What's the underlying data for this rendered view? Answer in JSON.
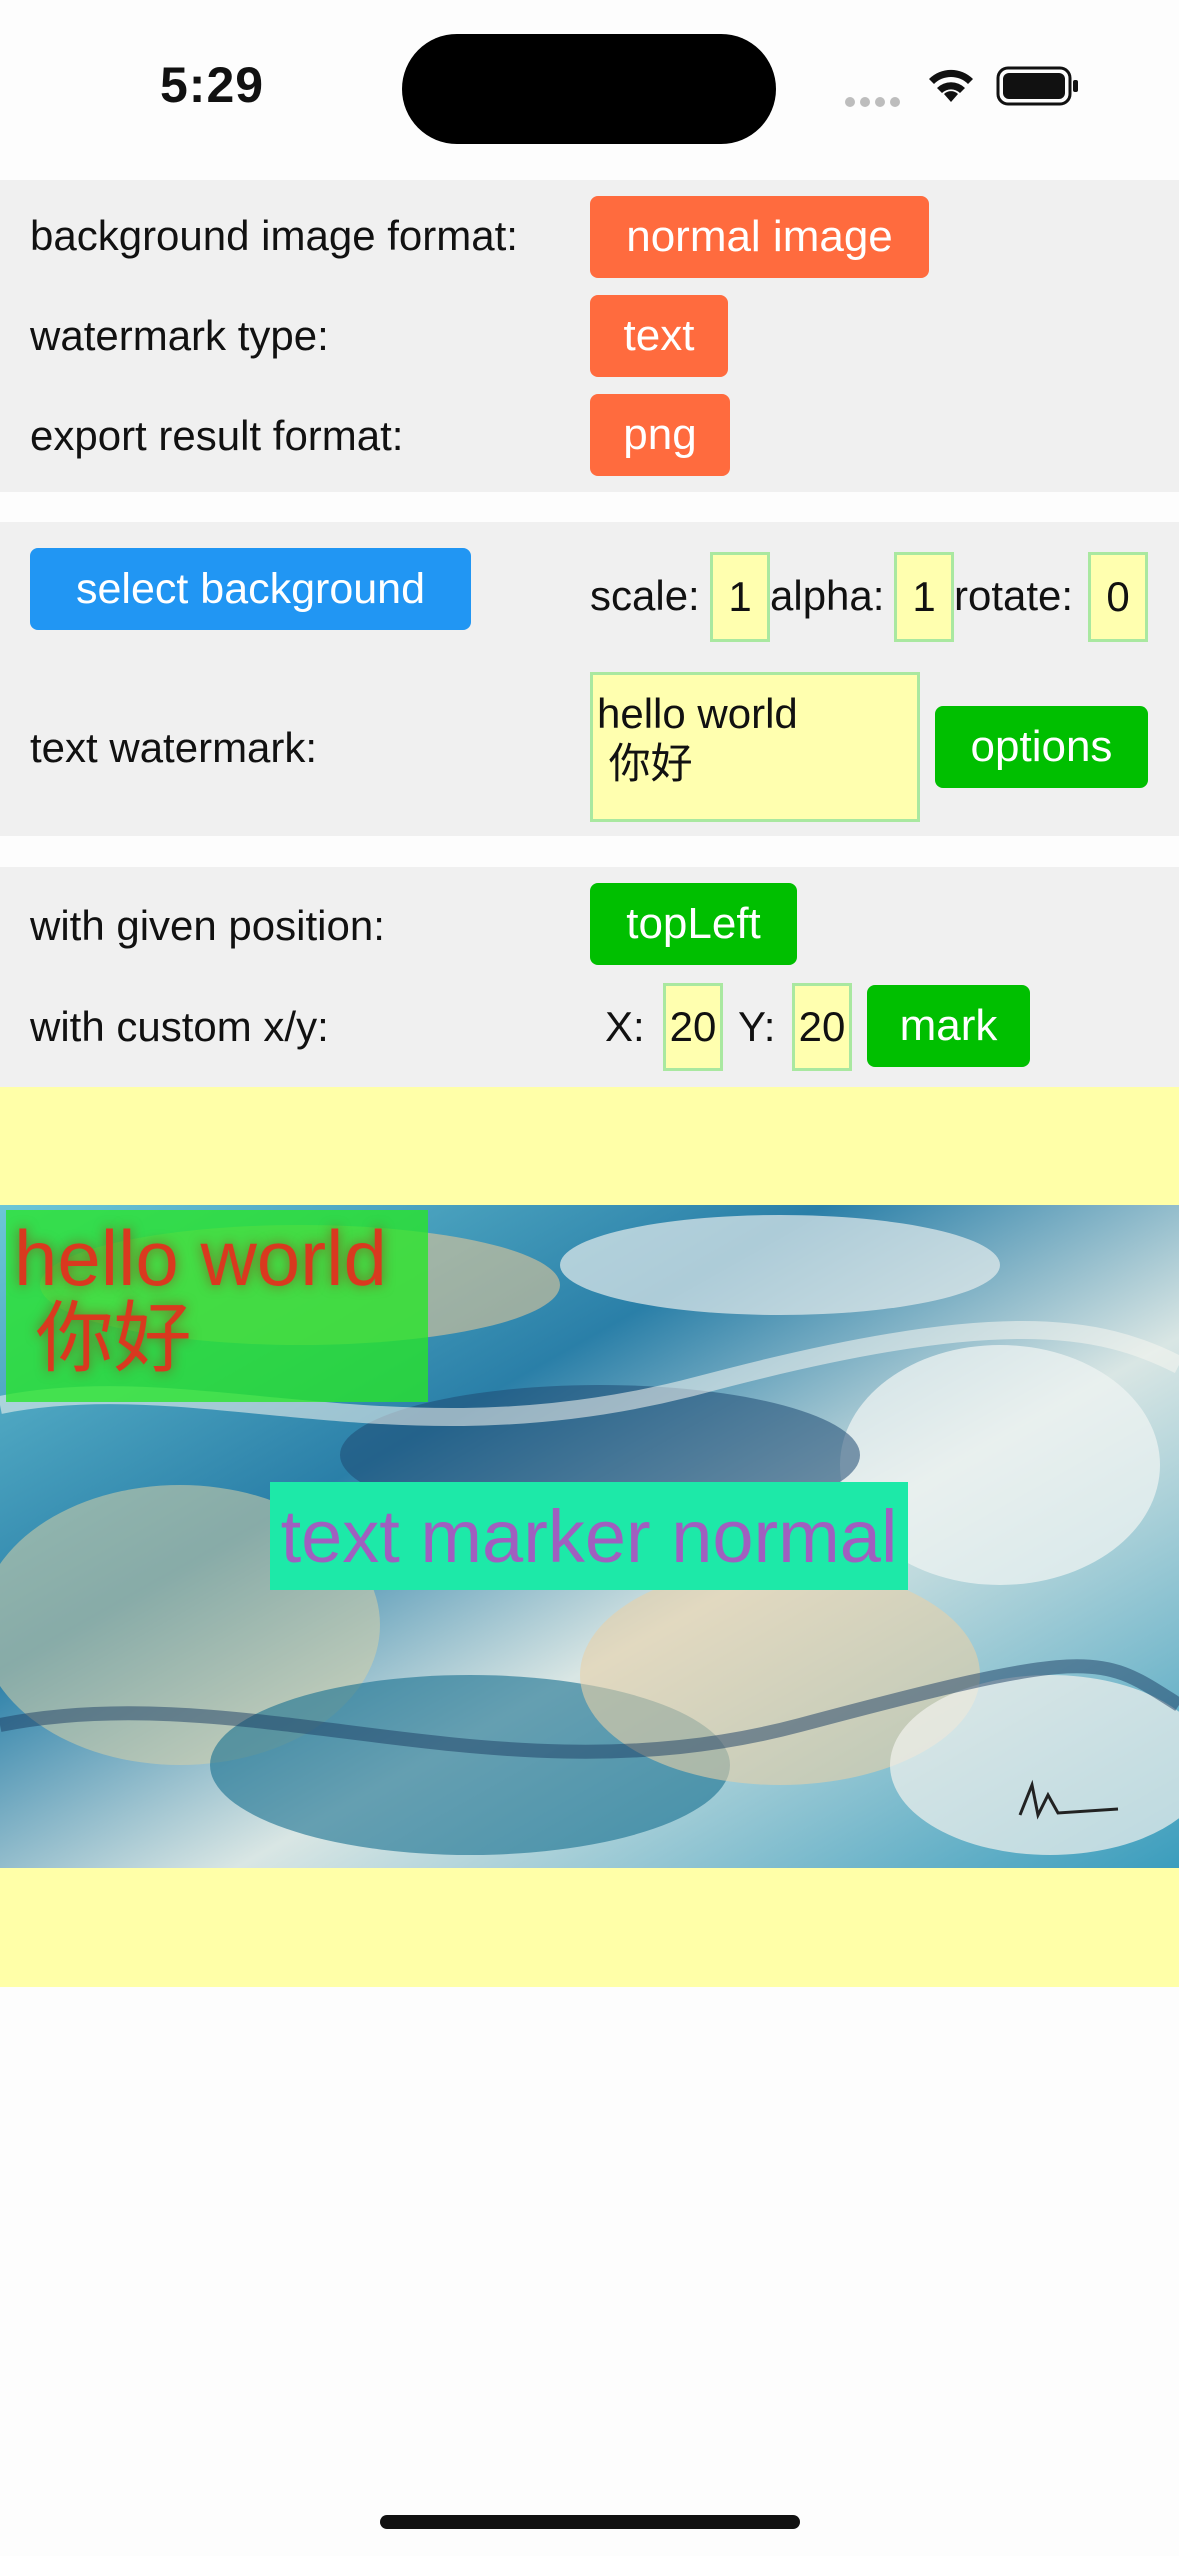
{
  "status_bar": {
    "time": "5:29"
  },
  "section1": {
    "bg_format_label": "background image format:",
    "bg_format_value": "normal image",
    "watermark_type_label": "watermark type:",
    "watermark_type_value": "text",
    "export_format_label": "export result format:",
    "export_format_value": "png"
  },
  "section2": {
    "select_background_label": "select background",
    "scale_label": "scale:",
    "scale_value": "1",
    "alpha_label": "alpha:",
    "alpha_value": "1",
    "rotate_label": "rotate:",
    "rotate_value": "0",
    "text_watermark_label": "text watermark:",
    "text_watermark_value": "hello world\n 你好",
    "options_label": "options"
  },
  "section3": {
    "given_position_label": "with given position:",
    "given_position_value": "topLeft",
    "custom_xy_label": "with custom x/y:",
    "x_label": "X:",
    "x_value": "20",
    "y_label": "Y:",
    "y_value": "20",
    "mark_label": "mark"
  },
  "preview": {
    "watermark_text": "hello world\n 你好",
    "marker_text": "text marker normal",
    "colors": {
      "panel": "#f0f0f0",
      "preview_bg": "#ffffa8",
      "watermark_bg": "#28e628",
      "marker_bg": "#1de9a8"
    }
  }
}
